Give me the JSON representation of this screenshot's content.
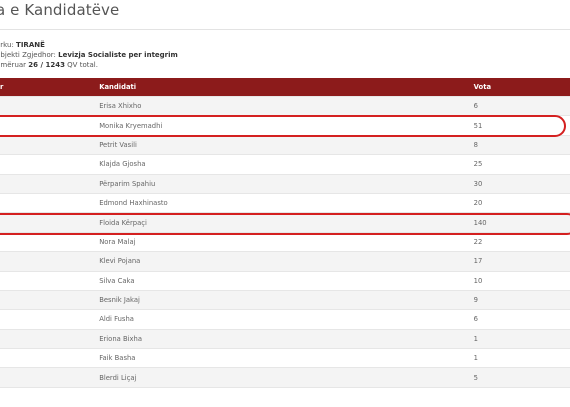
{
  "page": {
    "title": "a e Kandidatëve"
  },
  "info": {
    "district_label": "arku:",
    "district_value": "TIRANË",
    "subject_label": "ubjekti Zgjedhor:",
    "subject_value": "Levizja Socialiste per integrim",
    "counted_label": "umëruar",
    "counted_value": "26 / 1243",
    "counted_suffix": "QV total."
  },
  "table": {
    "headers": {
      "col1": "r",
      "col2": "Kandidati",
      "col3": "Vota"
    },
    "rows": [
      {
        "name": "Erisa Xhixho",
        "votes": "6"
      },
      {
        "name": "Monika Kryemadhi",
        "votes": "51"
      },
      {
        "name": "Petrit Vasili",
        "votes": "8"
      },
      {
        "name": "Klajda Gjosha",
        "votes": "25"
      },
      {
        "name": "Përparim Spahiu",
        "votes": "30"
      },
      {
        "name": "Edmond Haxhinasto",
        "votes": "20"
      },
      {
        "name": "Floida Kërpaçi",
        "votes": "140"
      },
      {
        "name": "Nora Malaj",
        "votes": "22"
      },
      {
        "name": "Klevi Pojana",
        "votes": "17"
      },
      {
        "name": "Silva Caka",
        "votes": "10"
      },
      {
        "name": "Besnik Jakaj",
        "votes": "9"
      },
      {
        "name": "Aldi Fusha",
        "votes": "6"
      },
      {
        "name": "Eriona Bixha",
        "votes": "1"
      },
      {
        "name": "Faik Basha",
        "votes": "1"
      },
      {
        "name": "Blerdi Liçaj",
        "votes": "5"
      },
      {
        "name": "",
        "votes": ""
      }
    ]
  },
  "colors": {
    "header_bg": "#8c1b1b",
    "highlight": "#d42020"
  }
}
